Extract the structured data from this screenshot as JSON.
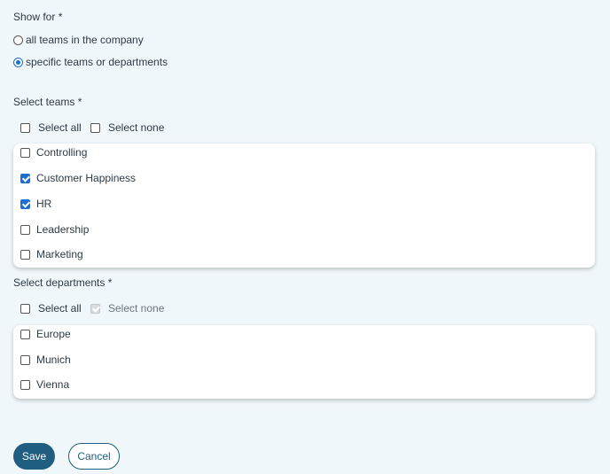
{
  "show_for": {
    "label": "Show for",
    "required_mark": "*",
    "options": [
      {
        "label": "all teams in the company",
        "selected": false
      },
      {
        "label": "specific teams or departments",
        "selected": true
      }
    ]
  },
  "teams": {
    "label": "Select teams",
    "required_mark": "*",
    "select_all": {
      "label": "Select all",
      "checked": false,
      "disabled": false
    },
    "select_none": {
      "label": "Select none",
      "checked": false,
      "disabled": false
    },
    "items": [
      {
        "label": "Controlling",
        "checked": false
      },
      {
        "label": "Customer Happiness",
        "checked": true
      },
      {
        "label": "HR",
        "checked": true
      },
      {
        "label": "Leadership",
        "checked": false
      },
      {
        "label": "Marketing",
        "checked": false
      }
    ]
  },
  "departments": {
    "label": "Select departments",
    "required_mark": "*",
    "select_all": {
      "label": "Select all",
      "checked": false,
      "disabled": false
    },
    "select_none": {
      "label": "Select none",
      "checked": true,
      "disabled": true
    },
    "items": [
      {
        "label": "Europe",
        "checked": false
      },
      {
        "label": "Munich",
        "checked": false
      },
      {
        "label": "Vienna",
        "checked": false
      }
    ]
  },
  "actions": {
    "save_label": "Save",
    "cancel_label": "Cancel"
  }
}
